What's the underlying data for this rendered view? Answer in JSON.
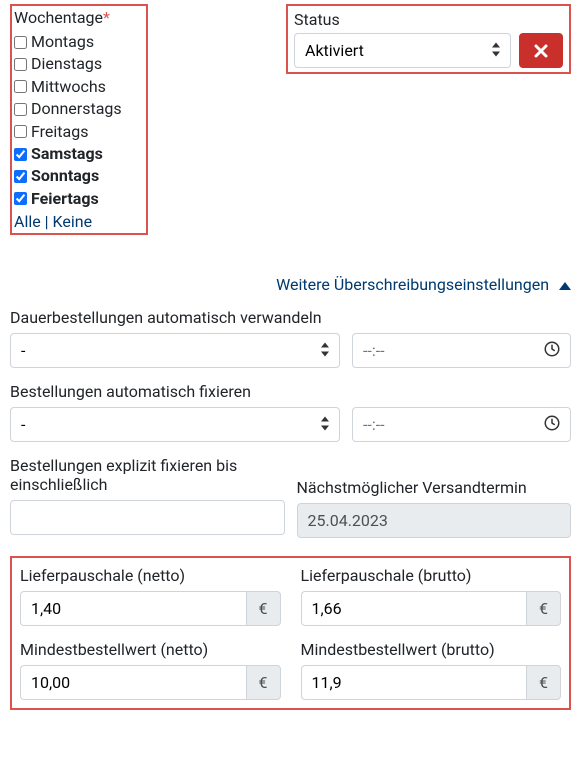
{
  "weekdays": {
    "label": "Wochentage",
    "items": [
      {
        "label": "Montags",
        "checked": false
      },
      {
        "label": "Dienstags",
        "checked": false
      },
      {
        "label": "Mittwochs",
        "checked": false
      },
      {
        "label": "Donnerstags",
        "checked": false
      },
      {
        "label": "Freitags",
        "checked": false
      },
      {
        "label": "Samstags",
        "checked": true
      },
      {
        "label": "Sonntags",
        "checked": true
      },
      {
        "label": "Feiertags",
        "checked": true
      }
    ],
    "all": "Alle",
    "none": "Keine"
  },
  "status": {
    "label": "Status",
    "value": "Aktiviert"
  },
  "more_settings": "Weitere Überschreibungseinstellungen",
  "auto_convert": {
    "label": "Dauerbestellungen automatisch verwandeln",
    "select_value": "-",
    "time_placeholder": "--:--"
  },
  "auto_fix": {
    "label": "Bestellungen automatisch fixieren",
    "select_value": "-",
    "time_placeholder": "--:--"
  },
  "fix_until": {
    "label": "Bestellungen explizit fixieren bis einschließlich",
    "value": ""
  },
  "next_ship": {
    "label": "Nächstmöglicher Versandtermin",
    "value": "25.04.2023"
  },
  "fees": {
    "flat_net_label": "Lieferpauschale (netto)",
    "flat_net_value": "1,40",
    "flat_gross_label": "Lieferpauschale (brutto)",
    "flat_gross_value": "1,66",
    "min_net_label": "Mindestbestellwert (netto)",
    "min_net_value": "10,00",
    "min_gross_label": "Mindestbestellwert (brutto)",
    "min_gross_value": "11,9",
    "currency": "€"
  }
}
